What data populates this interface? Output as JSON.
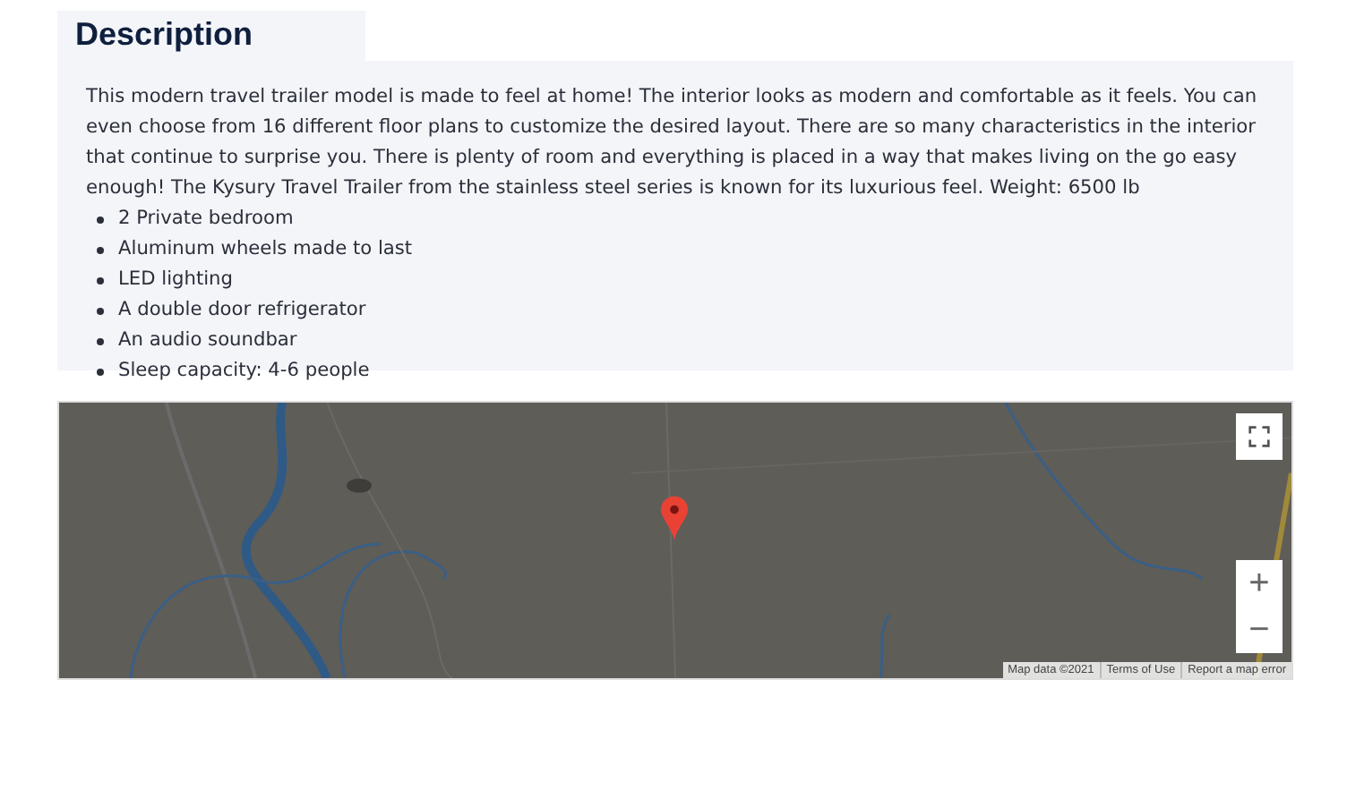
{
  "description": {
    "title": "Description",
    "text": "This modern travel trailer model is made to feel at home! The interior looks as modern and comfortable as it feels. You can even choose from 16 different floor plans to customize the desired layout. There are so many characteristics in the interior that continue to surprise you. There is plenty of room and everything is placed in a way that makes living on the go easy enough! The Kysury Travel Trailer from the stainless steel series is known for its luxurious feel. Weight: 6500 lb",
    "features": [
      "2 Private bedroom",
      "Aluminum wheels made to last",
      "LED lighting",
      "A double door refrigerator",
      "An audio soundbar",
      "Sleep capacity: 4-6 people"
    ]
  },
  "map": {
    "kind": "picture",
    "zoom_in": "+",
    "zoom_out": "−",
    "attribution": [
      "Map data ©2021",
      "Terms of Use",
      "Report a map error"
    ]
  }
}
